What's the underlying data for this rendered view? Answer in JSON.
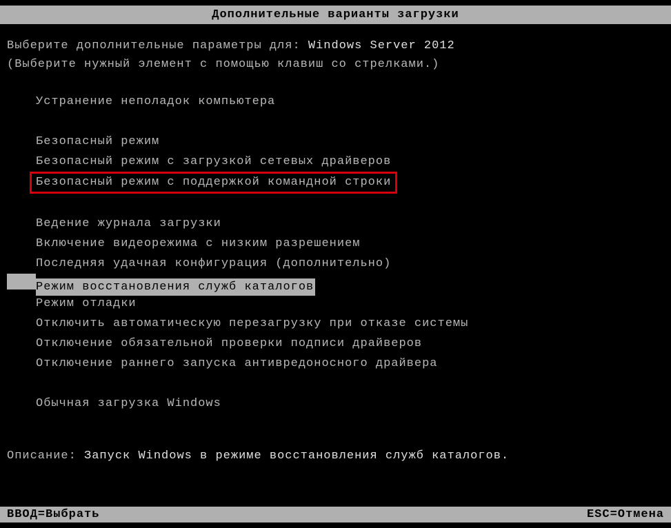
{
  "title": "Дополнительные варианты загрузки",
  "prompt_prefix": "Выберите дополнительные параметры для:",
  "os_name": "Windows Server 2012",
  "instruction": "(Выберите нужный элемент с помощью клавиш со стрелками.)",
  "menu": {
    "group1": [
      "Устранение неполадок компьютера"
    ],
    "group2": [
      "Безопасный режим",
      "Безопасный режим с загрузкой сетевых драйверов",
      "Безопасный режим с поддержкой командной строки"
    ],
    "group3": [
      "Ведение журнала загрузки",
      "Включение видеорежима с низким разрешением",
      "Последняя удачная конфигурация (дополнительно)",
      "Режим восстановления служб каталогов",
      "Режим отладки",
      "Отключить автоматическую перезагрузку при отказе системы",
      "Отключение обязательной проверки подписи драйверов",
      "Отключение раннего запуска антивредоносного драйвера"
    ],
    "group4": [
      "Обычная загрузка Windows"
    ]
  },
  "description_label": "Описание:",
  "description_text": "Запуск Windows в режиме восстановления служб каталогов.",
  "footer": {
    "enter": "ВВОД=Выбрать",
    "esc": "ESC=Отмена"
  },
  "highlighted_item_text": "Безопасный режим с поддержкой командной строки",
  "selected_item_text": "Режим восстановления служб каталогов"
}
